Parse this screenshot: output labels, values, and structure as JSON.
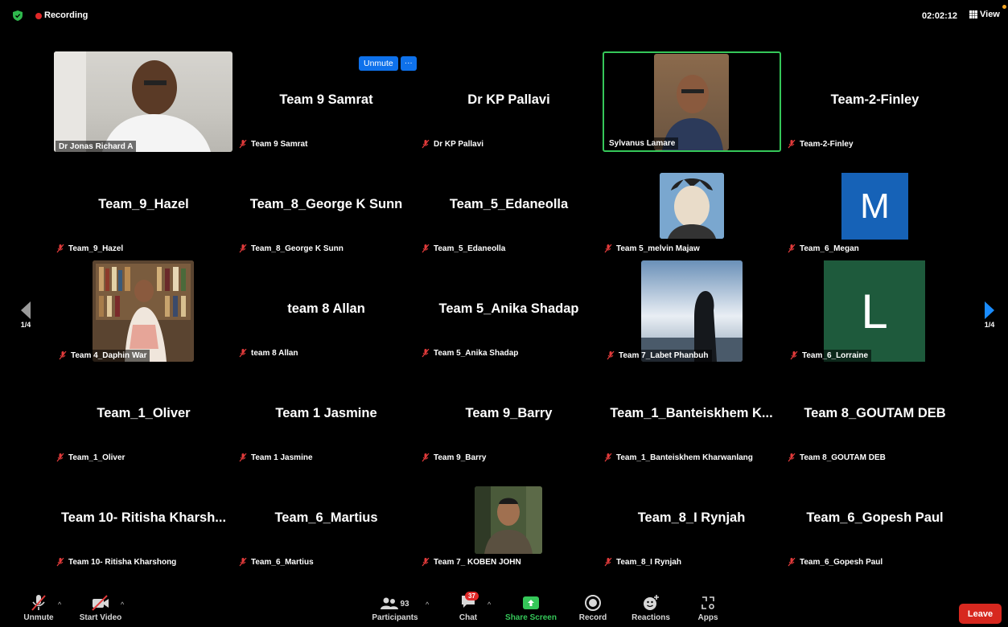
{
  "topbar": {
    "recording_label": "Recording",
    "timer": "02:02:12",
    "view_label": "View"
  },
  "spotlight_controls": {
    "unmute_label": "Unmute",
    "more_label": "···"
  },
  "pagination": {
    "left_label": "1/4",
    "right_label": "1/4"
  },
  "tiles": [
    {
      "center": "",
      "label": "Dr Jonas Richard A"
    },
    {
      "center": "Team 9 Samrat",
      "label": "Team 9 Samrat"
    },
    {
      "center": "Dr KP Pallavi",
      "label": "Dr KP Pallavi"
    },
    {
      "center": "",
      "label": "Sylvanus Lamare"
    },
    {
      "center": "Team-2-Finley",
      "label": "Team-2-Finley"
    },
    {
      "center": "Team_9_Hazel",
      "label": "Team_9_Hazel"
    },
    {
      "center": "Team_8_George K Sunn",
      "label": "Team_8_George K Sunn"
    },
    {
      "center": "Team_5_Edaneolla",
      "label": "Team_5_Edaneolla"
    },
    {
      "center": "",
      "label": "Team 5_melvin Majaw"
    },
    {
      "center": "",
      "label": "Team_6_Megan",
      "avatar": "M"
    },
    {
      "center": "",
      "label": "Team 4_Daphin War"
    },
    {
      "center": "team 8 Allan",
      "label": "team 8 Allan"
    },
    {
      "center": "Team 5_Anika Shadap",
      "label": "Team 5_Anika Shadap"
    },
    {
      "center": "",
      "label": "Team 7_Labet Phanbuh"
    },
    {
      "center": "",
      "label": "Team_6_Lorraine",
      "avatar": "L"
    },
    {
      "center": "Team_1_Oliver",
      "label": "Team_1_Oliver"
    },
    {
      "center": "Team 1 Jasmine",
      "label": "Team 1 Jasmine"
    },
    {
      "center": "Team 9_Barry",
      "label": "Team 9_Barry"
    },
    {
      "center": "Team_1_Banteiskhem K...",
      "label": "Team_1_Banteiskhem Kharwanlang"
    },
    {
      "center": "Team 8_GOUTAM DEB",
      "label": "Team 8_GOUTAM DEB"
    },
    {
      "center": "Team 10- Ritisha Kharsh...",
      "label": "Team 10- Ritisha Kharshong"
    },
    {
      "center": "Team_6_Martius",
      "label": "Team_6_Martius"
    },
    {
      "center": "",
      "label": "Team 7_ KOBEN JOHN"
    },
    {
      "center": "Team_8_I Rynjah",
      "label": "Team_8_I Rynjah"
    },
    {
      "center": "Team_6_Gopesh Paul",
      "label": "Team_6_Gopesh Paul"
    }
  ],
  "toolbar": {
    "unmute": "Unmute",
    "start_video": "Start Video",
    "participants": "Participants",
    "participants_count": "93",
    "chat": "Chat",
    "chat_badge": "37",
    "share_screen": "Share Screen",
    "record": "Record",
    "reactions": "Reactions",
    "apps": "Apps",
    "leave": "Leave"
  },
  "colors": {
    "accent_blue": "#0e71eb",
    "share_green": "#35c759",
    "leave_red": "#d7281f",
    "active_border": "#35c759"
  }
}
